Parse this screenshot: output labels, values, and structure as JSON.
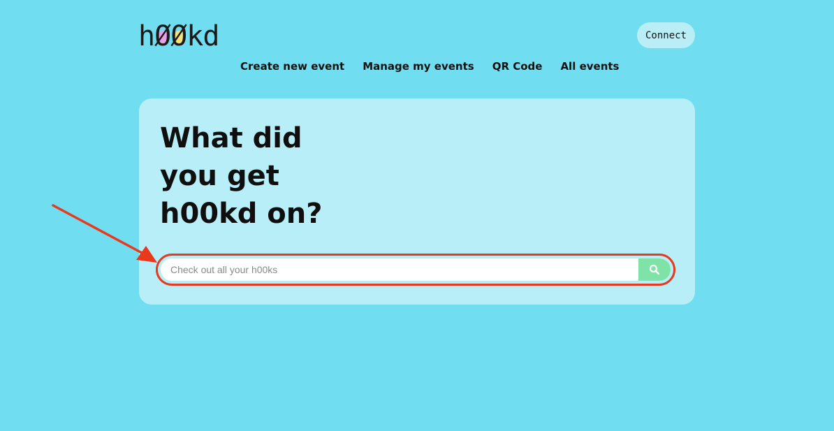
{
  "logo": {
    "part1": "h",
    "o1": "Ø",
    "o2": "Ø",
    "part2": "kd",
    "o1_color": "#e9a0e8",
    "o2_color": "#f6e07a"
  },
  "header": {
    "connect_label": "Connect"
  },
  "nav": {
    "items": [
      {
        "label": "Create new event"
      },
      {
        "label": "Manage my events"
      },
      {
        "label": "QR Code"
      },
      {
        "label": "All events"
      }
    ]
  },
  "hero": {
    "line1": "What did",
    "line2": "you get",
    "line3": "h00kd on?"
  },
  "search": {
    "placeholder": "Check out all your h00ks",
    "value": "",
    "icon": "search-icon"
  },
  "colors": {
    "background": "#70def0",
    "card": "#b8eef7",
    "search_button": "#7fe3a8",
    "annotation": "#e8381d"
  }
}
